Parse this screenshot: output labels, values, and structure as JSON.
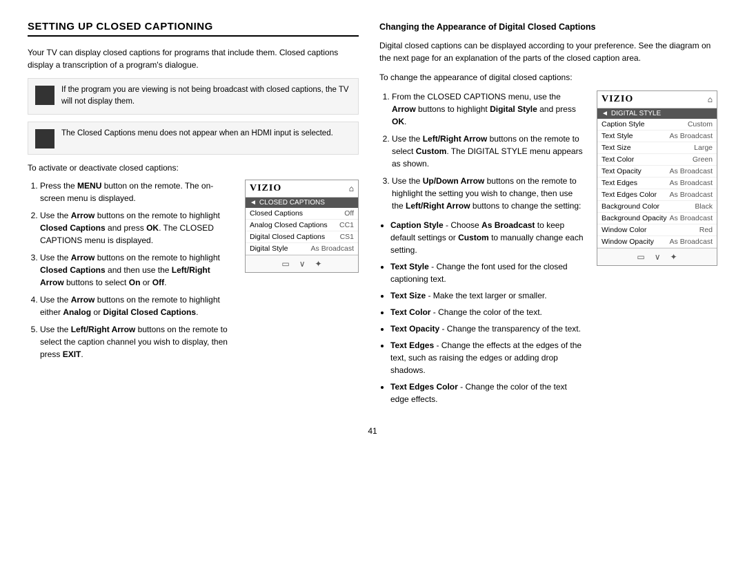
{
  "page": {
    "number": "41",
    "left_column": {
      "title": "SETTING UP CLOSED CAPTIONING",
      "intro_paragraph": "Your TV can display closed captions for programs that include them. Closed captions display a transcription of a program's dialogue.",
      "notices": [
        {
          "id": "notice-1",
          "text": "If the program you are viewing is not being broadcast with closed captions, the TV will not display them."
        },
        {
          "id": "notice-2",
          "text": "The Closed Captions menu does not appear when an HDMI input is selected."
        }
      ],
      "steps_intro": "To activate or deactivate closed captions:",
      "steps": [
        {
          "id": 1,
          "html": "Press the <b>MENU</b> button on the remote. The on-screen menu is displayed.",
          "text": "Press the MENU button on the remote. The on-screen menu is displayed."
        },
        {
          "id": 2,
          "html": "Use the <b>Arrow</b> buttons on the remote to highlight <b>Closed Captions</b> and press <b>OK</b>. The CLOSED CAPTIONS menu is displayed.",
          "text": "Use the Arrow buttons on the remote to highlight Closed Captions and press OK. The CLOSED CAPTIONS menu is displayed."
        },
        {
          "id": 3,
          "html": "Use the <b>Arrow</b> buttons on the remote to highlight <b>Closed Captions</b> and then use the <b>Left/Right Arrow</b> buttons to select <b>On</b> or <b>Off</b>.",
          "text": "Use the Arrow buttons on the remote to highlight Closed Captions and then use the Left/Right Arrow buttons to select On or Off."
        },
        {
          "id": 4,
          "html": "Use the <b>Arrow</b> buttons on the remote to highlight either <b>Analog</b> or <b>Digital Closed Captions</b>.",
          "text": "Use the Arrow buttons on the remote to highlight either Analog or Digital Closed Captions."
        },
        {
          "id": 5,
          "html": "Use the <b>Left/Right Arrow</b> buttons on the remote to select the caption channel you wish to display, then press <b>EXIT</b>.",
          "text": "Use the Left/Right Arrow buttons on the remote to select the caption channel you wish to display, then press EXIT."
        }
      ],
      "menu": {
        "logo": "VIZIO",
        "section_title": "CLOSED CAPTIONS",
        "rows": [
          {
            "label": "Closed Captions",
            "value": "Off"
          },
          {
            "label": "Analog Closed Captions",
            "value": "CC1"
          },
          {
            "label": "Digital Closed Captions",
            "value": "CS1"
          },
          {
            "label": "Digital Style",
            "value": "As Broadcast"
          }
        ],
        "footer_icons": [
          "rectangle-icon",
          "down-arrow-icon",
          "gear-icon"
        ]
      }
    },
    "right_column": {
      "section_title": "Changing the Appearance of Digital Closed Captions",
      "intro_paragraph": "Digital closed captions can be displayed according to your preference. See the diagram on the next page for an explanation of the parts of the closed caption area.",
      "steps_intro": "To change the appearance of digital closed captions:",
      "steps": [
        {
          "id": 1,
          "html": "From the CLOSED CAPTIONS menu, use the <b>Arrow</b> buttons to highlight <b>Digital Style</b> and press <b>OK</b>.",
          "text": "From the CLOSED CAPTIONS menu, use the Arrow buttons to highlight Digital Style and press OK."
        },
        {
          "id": 2,
          "html": "Use the <b>Left/Right Arrow</b> buttons on the remote to select <b>Custom</b>. The DIGITAL STYLE menu appears as shown.",
          "text": "Use the Left/Right Arrow buttons on the remote to select Custom. The DIGITAL STYLE menu appears as shown."
        },
        {
          "id": 3,
          "html": "Use the <b>Up/Down Arrow</b> buttons on the remote to highlight the setting you wish to change, then use the <b>Left/Right Arrow</b> buttons to change the setting:",
          "text": "Use the Up/Down Arrow buttons on the remote to highlight the setting you wish to change, then use the Left/Right Arrow buttons to change the setting:"
        }
      ],
      "bullet_points": [
        {
          "id": "caption-style",
          "html": "<b>Caption Style</b> - Choose <b>As Broadcast</b> to keep default settings or <b>Custom</b> to manually change each setting.",
          "text": "Caption Style - Choose As Broadcast to keep default settings or Custom to manually change each setting."
        },
        {
          "id": "text-style",
          "html": "<b>Text Style</b>  - Change the font used for the closed captioning text.",
          "text": "Text Style - Change the font used for the closed captioning text."
        },
        {
          "id": "text-size",
          "html": "<b>Text Size</b> - Make the text larger or smaller.",
          "text": "Text Size - Make the text larger or smaller."
        },
        {
          "id": "text-color",
          "html": "<b>Text Color</b> - Change the color of the text.",
          "text": "Text Color - Change the color of the text."
        },
        {
          "id": "text-opacity",
          "html": "<b>Text Opacity</b> - Change the transparency of the text.",
          "text": "Text Opacity - Change the transparency of the text."
        },
        {
          "id": "text-edges",
          "html": "<b>Text Edges</b> - Change the effects at the edges of the text, such as raising the edges or adding drop shadows.",
          "text": "Text Edges - Change the effects at the edges of the text, such as raising the edges or adding drop shadows."
        },
        {
          "id": "text-edges-color",
          "html": "<b>Text Edges Color</b> - Change the color of the text edge effects.",
          "text": "Text Edges Color - Change the color of the text edge effects."
        }
      ],
      "menu": {
        "logo": "VIZIO",
        "section_title": "DIGITAL STYLE",
        "rows": [
          {
            "label": "Caption Style",
            "value": "Custom"
          },
          {
            "label": "Text Style",
            "value": "As Broadcast"
          },
          {
            "label": "Text Size",
            "value": "Large"
          },
          {
            "label": "Text Color",
            "value": "Green"
          },
          {
            "label": "Text Opacity",
            "value": "As Broadcast"
          },
          {
            "label": "Text Edges",
            "value": "As Broadcast"
          },
          {
            "label": "Text Edges Color",
            "value": "As Broadcast"
          },
          {
            "label": "Background Color",
            "value": "Black"
          },
          {
            "label": "Background Opacity",
            "value": "As Broadcast"
          },
          {
            "label": "Window Color",
            "value": "Red"
          },
          {
            "label": "Window Opacity",
            "value": "As Broadcast"
          }
        ],
        "footer_icons": [
          "rectangle-icon",
          "down-arrow-icon",
          "gear-icon"
        ]
      }
    }
  }
}
